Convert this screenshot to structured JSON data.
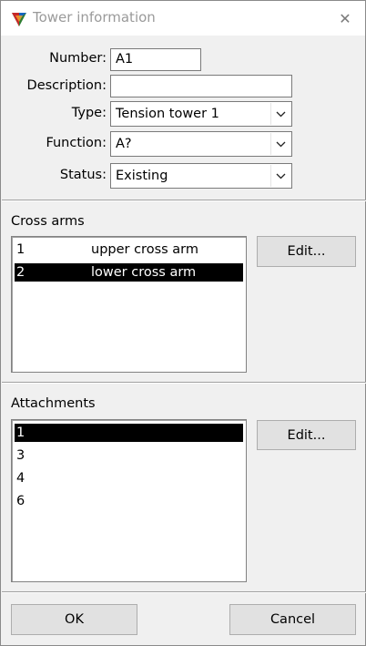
{
  "window": {
    "title": "Tower information",
    "close_glyph": "✕"
  },
  "form": {
    "number_label": "Number:",
    "number_value": "A1",
    "description_label": "Description:",
    "description_value": "",
    "type_label": "Type:",
    "type_value": "Tension tower 1",
    "function_label": "Function:",
    "function_value": "A?",
    "status_label": "Status:",
    "status_value": "Existing"
  },
  "cross_arms": {
    "title": "Cross arms",
    "edit_label": "Edit...",
    "items": [
      {
        "id": "1",
        "name": "upper cross arm",
        "selected": false
      },
      {
        "id": "2",
        "name": "lower cross arm",
        "selected": true
      }
    ]
  },
  "attachments": {
    "title": "Attachments",
    "edit_label": "Edit...",
    "items": [
      {
        "id": "1",
        "selected": true
      },
      {
        "id": "3",
        "selected": false
      },
      {
        "id": "4",
        "selected": false
      },
      {
        "id": "6",
        "selected": false
      }
    ]
  },
  "footer": {
    "ok_label": "OK",
    "cancel_label": "Cancel"
  },
  "colors": {
    "selection_bg": "#000000",
    "selection_fg": "#ffffff",
    "dialog_bg": "#f0f0f0",
    "button_bg": "#e1e1e1"
  },
  "icons": {
    "app": "tower-app-icon",
    "close": "close-icon",
    "dropdown": "chevron-down-icon"
  }
}
